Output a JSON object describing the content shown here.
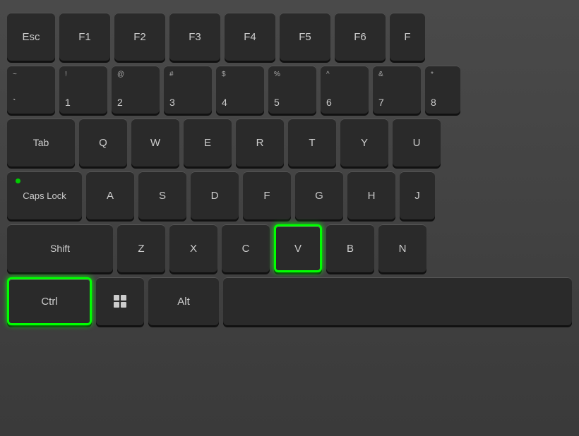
{
  "keyboard": {
    "rows": [
      {
        "id": "function-row",
        "keys": [
          {
            "id": "esc",
            "label": "Esc",
            "type": "center"
          },
          {
            "id": "f1",
            "label": "F1",
            "type": "center"
          },
          {
            "id": "f2",
            "label": "F2",
            "type": "center"
          },
          {
            "id": "f3",
            "label": "F3",
            "type": "center"
          },
          {
            "id": "f4",
            "label": "F4",
            "type": "center"
          },
          {
            "id": "f5",
            "label": "F5",
            "type": "center"
          },
          {
            "id": "f6",
            "label": "F6",
            "type": "center"
          },
          {
            "id": "f7",
            "label": "F",
            "type": "center",
            "partial": true
          }
        ]
      },
      {
        "id": "number-row",
        "keys": [
          {
            "id": "tilde",
            "top": "~",
            "bottom": "`",
            "type": "dual"
          },
          {
            "id": "1",
            "top": "!",
            "bottom": "1",
            "type": "dual"
          },
          {
            "id": "2",
            "top": "@",
            "bottom": "2",
            "type": "dual"
          },
          {
            "id": "3",
            "top": "#",
            "bottom": "3",
            "type": "dual"
          },
          {
            "id": "4",
            "top": "$",
            "bottom": "4",
            "type": "dual"
          },
          {
            "id": "5",
            "top": "%",
            "bottom": "5",
            "type": "dual"
          },
          {
            "id": "6",
            "top": "^",
            "bottom": "6",
            "type": "dual"
          },
          {
            "id": "7",
            "top": "&",
            "bottom": "7",
            "type": "dual"
          },
          {
            "id": "8",
            "top": "*",
            "bottom": "8",
            "type": "dual",
            "partial": true
          }
        ]
      },
      {
        "id": "qwerty-row",
        "keys": [
          {
            "id": "tab",
            "label": "Tab",
            "type": "center"
          },
          {
            "id": "q",
            "label": "Q",
            "type": "center"
          },
          {
            "id": "w",
            "label": "W",
            "type": "center"
          },
          {
            "id": "e",
            "label": "E",
            "type": "center"
          },
          {
            "id": "r",
            "label": "R",
            "type": "center"
          },
          {
            "id": "t",
            "label": "T",
            "type": "center"
          },
          {
            "id": "y",
            "label": "Y",
            "type": "center"
          },
          {
            "id": "u",
            "label": "U",
            "type": "center"
          }
        ]
      },
      {
        "id": "asdf-row",
        "keys": [
          {
            "id": "caps",
            "label": "Caps Lock",
            "type": "center",
            "hasDot": true
          },
          {
            "id": "a",
            "label": "A",
            "type": "center"
          },
          {
            "id": "s",
            "label": "S",
            "type": "center"
          },
          {
            "id": "d",
            "label": "D",
            "type": "center"
          },
          {
            "id": "f",
            "label": "F",
            "type": "center"
          },
          {
            "id": "g",
            "label": "G",
            "type": "center"
          },
          {
            "id": "h",
            "label": "H",
            "type": "center"
          },
          {
            "id": "j",
            "label": "J",
            "type": "center",
            "partial": true
          }
        ]
      },
      {
        "id": "zxcv-row",
        "keys": [
          {
            "id": "shift",
            "label": "Shift",
            "type": "center"
          },
          {
            "id": "z",
            "label": "Z",
            "type": "center"
          },
          {
            "id": "x",
            "label": "X",
            "type": "center"
          },
          {
            "id": "c",
            "label": "C",
            "type": "center"
          },
          {
            "id": "v",
            "label": "V",
            "type": "center",
            "highlighted": true
          },
          {
            "id": "b",
            "label": "B",
            "type": "center"
          },
          {
            "id": "n",
            "label": "N",
            "type": "center"
          }
        ]
      },
      {
        "id": "bottom-row",
        "keys": [
          {
            "id": "ctrl",
            "label": "Ctrl",
            "type": "center",
            "highlighted": true
          },
          {
            "id": "win",
            "label": "win",
            "type": "winkey"
          },
          {
            "id": "alt",
            "label": "Alt",
            "type": "center"
          },
          {
            "id": "space",
            "label": "",
            "type": "center"
          }
        ]
      }
    ]
  }
}
